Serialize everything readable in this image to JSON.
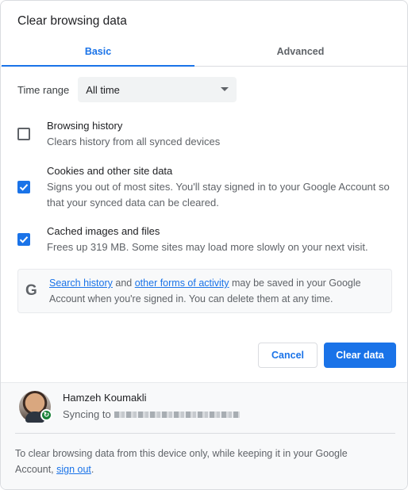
{
  "dialog": {
    "title": "Clear browsing data"
  },
  "tabs": [
    {
      "label": "Basic",
      "selected": true
    },
    {
      "label": "Advanced",
      "selected": false
    }
  ],
  "time_range": {
    "label": "Time range",
    "value": "All time"
  },
  "options": [
    {
      "title": "Browsing history",
      "desc": "Clears history from all synced devices",
      "checked": false
    },
    {
      "title": "Cookies and other site data",
      "desc": "Signs you out of most sites. You'll stay signed in to your Google Account so that your synced data can be cleared.",
      "checked": true
    },
    {
      "title": "Cached images and files",
      "desc": "Frees up 319 MB. Some sites may load more slowly on your next visit.",
      "checked": true
    }
  ],
  "info": {
    "icon": "google-g-icon",
    "icon_glyph": "G",
    "link1": "Search history",
    "and": "and",
    "link2": "other forms of activity",
    "rest": "may be saved in your Google Account when you're signed in. You can delete them at any time."
  },
  "buttons": {
    "cancel": "Cancel",
    "clear": "Clear data"
  },
  "account": {
    "name": "Hamzeh Koumakli",
    "syncing_prefix": "Syncing to",
    "badge_icon": "sync-icon"
  },
  "footer": {
    "note_prefix": "To clear browsing data from this device only, while keeping it in your Google Account,",
    "sign_out": "sign out",
    "note_suffix": "."
  },
  "colors": {
    "accent": "#1a73e8",
    "text": "#202124",
    "secondary": "#5f6368",
    "sync_green": "#188038"
  }
}
